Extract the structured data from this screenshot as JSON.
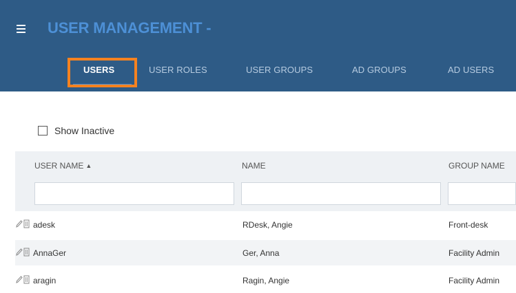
{
  "header": {
    "title": "USER MANAGEMENT -"
  },
  "tabs": [
    {
      "label": "USERS",
      "active": true
    },
    {
      "label": "USER ROLES",
      "active": false
    },
    {
      "label": "USER GROUPS",
      "active": false
    },
    {
      "label": "AD GROUPS",
      "active": false
    },
    {
      "label": "AD USERS",
      "active": false
    }
  ],
  "filters": {
    "show_inactive_label": "Show Inactive",
    "show_inactive_checked": false
  },
  "table": {
    "columns": [
      {
        "label": "USER NAME",
        "sort_icon": "sort-updown-icon"
      },
      {
        "label": "NAME"
      },
      {
        "label": "GROUP NAME"
      }
    ],
    "filter_values": [
      "",
      "",
      ""
    ],
    "rows": [
      {
        "user_name": "adesk",
        "name": "RDesk, Angie",
        "group_name": "Front-desk"
      },
      {
        "user_name": "AnnaGer",
        "name": "Ger, Anna",
        "group_name": "Facility Admin"
      },
      {
        "user_name": "aragin",
        "name": "Ragin, Angie",
        "group_name": "Facility Admin"
      }
    ]
  },
  "colors": {
    "header_bg": "#2e5b86",
    "title_color": "#4d90d6",
    "highlight": "#f58220"
  }
}
